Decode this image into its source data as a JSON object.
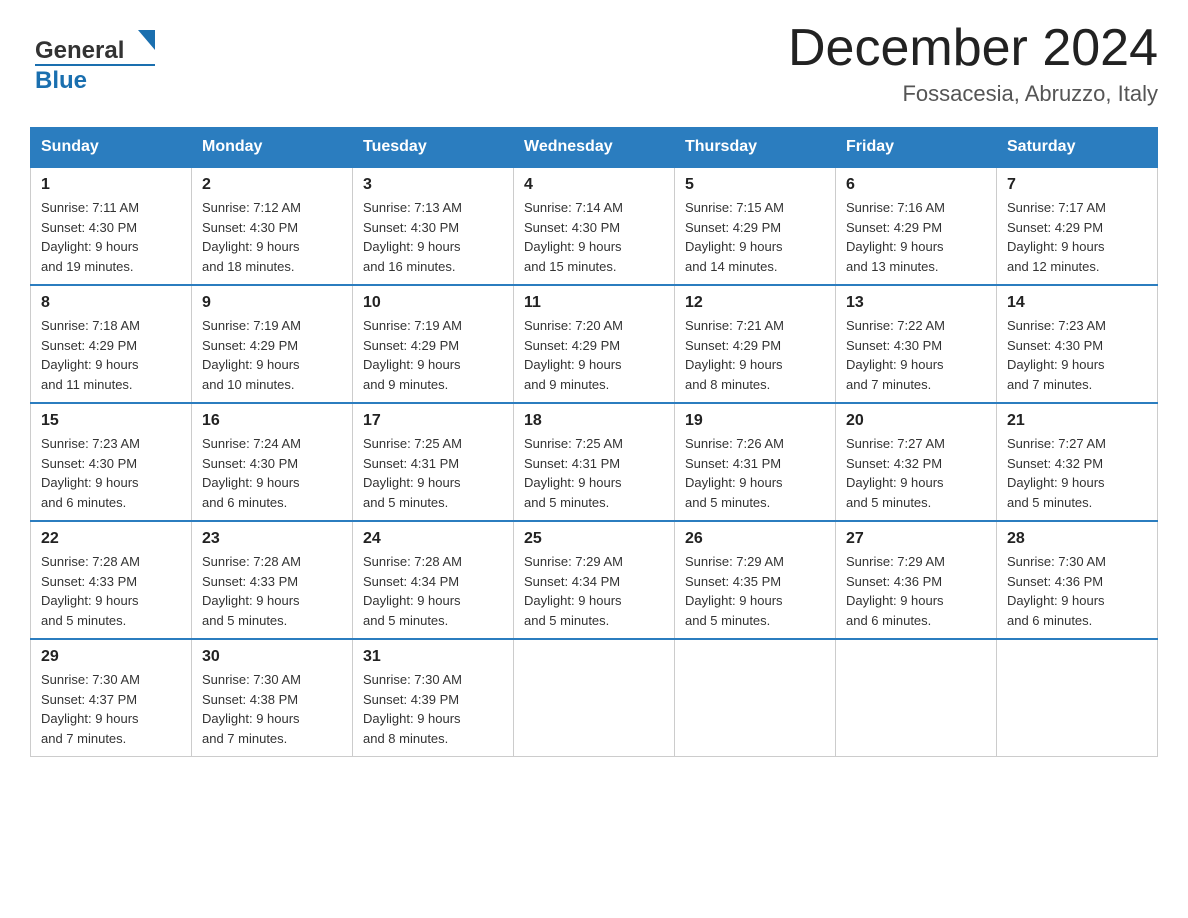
{
  "logo": {
    "general": "General",
    "blue": "Blue",
    "arrow_char": "▶"
  },
  "title": "December 2024",
  "subtitle": "Fossacesia, Abruzzo, Italy",
  "header_days": [
    "Sunday",
    "Monday",
    "Tuesday",
    "Wednesday",
    "Thursday",
    "Friday",
    "Saturday"
  ],
  "weeks": [
    [
      {
        "day": "1",
        "sunrise": "7:11 AM",
        "sunset": "4:30 PM",
        "daylight": "9 hours and 19 minutes."
      },
      {
        "day": "2",
        "sunrise": "7:12 AM",
        "sunset": "4:30 PM",
        "daylight": "9 hours and 18 minutes."
      },
      {
        "day": "3",
        "sunrise": "7:13 AM",
        "sunset": "4:30 PM",
        "daylight": "9 hours and 16 minutes."
      },
      {
        "day": "4",
        "sunrise": "7:14 AM",
        "sunset": "4:30 PM",
        "daylight": "9 hours and 15 minutes."
      },
      {
        "day": "5",
        "sunrise": "7:15 AM",
        "sunset": "4:29 PM",
        "daylight": "9 hours and 14 minutes."
      },
      {
        "day": "6",
        "sunrise": "7:16 AM",
        "sunset": "4:29 PM",
        "daylight": "9 hours and 13 minutes."
      },
      {
        "day": "7",
        "sunrise": "7:17 AM",
        "sunset": "4:29 PM",
        "daylight": "9 hours and 12 minutes."
      }
    ],
    [
      {
        "day": "8",
        "sunrise": "7:18 AM",
        "sunset": "4:29 PM",
        "daylight": "9 hours and 11 minutes."
      },
      {
        "day": "9",
        "sunrise": "7:19 AM",
        "sunset": "4:29 PM",
        "daylight": "9 hours and 10 minutes."
      },
      {
        "day": "10",
        "sunrise": "7:19 AM",
        "sunset": "4:29 PM",
        "daylight": "9 hours and 9 minutes."
      },
      {
        "day": "11",
        "sunrise": "7:20 AM",
        "sunset": "4:29 PM",
        "daylight": "9 hours and 9 minutes."
      },
      {
        "day": "12",
        "sunrise": "7:21 AM",
        "sunset": "4:29 PM",
        "daylight": "9 hours and 8 minutes."
      },
      {
        "day": "13",
        "sunrise": "7:22 AM",
        "sunset": "4:30 PM",
        "daylight": "9 hours and 7 minutes."
      },
      {
        "day": "14",
        "sunrise": "7:23 AM",
        "sunset": "4:30 PM",
        "daylight": "9 hours and 7 minutes."
      }
    ],
    [
      {
        "day": "15",
        "sunrise": "7:23 AM",
        "sunset": "4:30 PM",
        "daylight": "9 hours and 6 minutes."
      },
      {
        "day": "16",
        "sunrise": "7:24 AM",
        "sunset": "4:30 PM",
        "daylight": "9 hours and 6 minutes."
      },
      {
        "day": "17",
        "sunrise": "7:25 AM",
        "sunset": "4:31 PM",
        "daylight": "9 hours and 5 minutes."
      },
      {
        "day": "18",
        "sunrise": "7:25 AM",
        "sunset": "4:31 PM",
        "daylight": "9 hours and 5 minutes."
      },
      {
        "day": "19",
        "sunrise": "7:26 AM",
        "sunset": "4:31 PM",
        "daylight": "9 hours and 5 minutes."
      },
      {
        "day": "20",
        "sunrise": "7:27 AM",
        "sunset": "4:32 PM",
        "daylight": "9 hours and 5 minutes."
      },
      {
        "day": "21",
        "sunrise": "7:27 AM",
        "sunset": "4:32 PM",
        "daylight": "9 hours and 5 minutes."
      }
    ],
    [
      {
        "day": "22",
        "sunrise": "7:28 AM",
        "sunset": "4:33 PM",
        "daylight": "9 hours and 5 minutes."
      },
      {
        "day": "23",
        "sunrise": "7:28 AM",
        "sunset": "4:33 PM",
        "daylight": "9 hours and 5 minutes."
      },
      {
        "day": "24",
        "sunrise": "7:28 AM",
        "sunset": "4:34 PM",
        "daylight": "9 hours and 5 minutes."
      },
      {
        "day": "25",
        "sunrise": "7:29 AM",
        "sunset": "4:34 PM",
        "daylight": "9 hours and 5 minutes."
      },
      {
        "day": "26",
        "sunrise": "7:29 AM",
        "sunset": "4:35 PM",
        "daylight": "9 hours and 5 minutes."
      },
      {
        "day": "27",
        "sunrise": "7:29 AM",
        "sunset": "4:36 PM",
        "daylight": "9 hours and 6 minutes."
      },
      {
        "day": "28",
        "sunrise": "7:30 AM",
        "sunset": "4:36 PM",
        "daylight": "9 hours and 6 minutes."
      }
    ],
    [
      {
        "day": "29",
        "sunrise": "7:30 AM",
        "sunset": "4:37 PM",
        "daylight": "9 hours and 7 minutes."
      },
      {
        "day": "30",
        "sunrise": "7:30 AM",
        "sunset": "4:38 PM",
        "daylight": "9 hours and 7 minutes."
      },
      {
        "day": "31",
        "sunrise": "7:30 AM",
        "sunset": "4:39 PM",
        "daylight": "9 hours and 8 minutes."
      },
      null,
      null,
      null,
      null
    ]
  ],
  "labels": {
    "sunrise": "Sunrise:",
    "sunset": "Sunset:",
    "daylight": "Daylight:"
  },
  "colors": {
    "header_bg": "#2b7dbf",
    "header_text": "#ffffff",
    "border": "#2b7dbf",
    "logo_blue": "#1a6faf"
  }
}
